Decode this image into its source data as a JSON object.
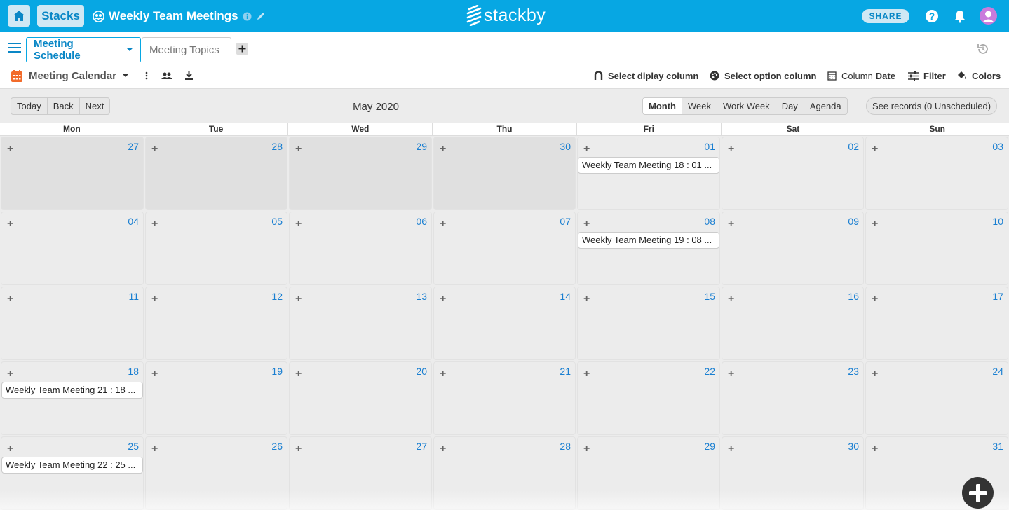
{
  "topbar": {
    "stacks_label": "Stacks",
    "stack_title": "Weekly Team Meetings",
    "logo_text": "stackby",
    "share_label": "SHARE",
    "icons": [
      "home-icon",
      "team-icon",
      "info-icon",
      "pencil-icon",
      "help-icon",
      "bell-icon",
      "user-avatar-icon"
    ],
    "colors": {
      "bar": "#07a7e3",
      "button_bg": "#cfe8f4",
      "accent": "#0a87c6"
    }
  },
  "tabs": [
    {
      "label": "Meeting Schedule",
      "active": true
    },
    {
      "label": "Meeting Topics",
      "active": false
    }
  ],
  "view_toolbar": {
    "view_name": "Meeting Calendar",
    "select_display_column": "Select diplay column",
    "select_option_column": "Select option column",
    "column_label": "Column",
    "column_value": "Date",
    "filter_label": "Filter",
    "colors_label": "Colors"
  },
  "calendar": {
    "nav": [
      "Today",
      "Back",
      "Next"
    ],
    "title": "May 2020",
    "views": [
      {
        "label": "Month",
        "active": true
      },
      {
        "label": "Week",
        "active": false
      },
      {
        "label": "Work Week",
        "active": false
      },
      {
        "label": "Day",
        "active": false
      },
      {
        "label": "Agenda",
        "active": false
      }
    ],
    "see_records": "See records (0 Unscheduled)",
    "weekdays": [
      "Mon",
      "Tue",
      "Wed",
      "Thu",
      "Fri",
      "Sat",
      "Sun"
    ],
    "weeks": [
      [
        {
          "day": "27",
          "off": true
        },
        {
          "day": "28",
          "off": true
        },
        {
          "day": "29",
          "off": true
        },
        {
          "day": "30",
          "off": true
        },
        {
          "day": "01",
          "event": "Weekly Team Meeting 18 : 01 ..."
        },
        {
          "day": "02"
        },
        {
          "day": "03"
        }
      ],
      [
        {
          "day": "04"
        },
        {
          "day": "05"
        },
        {
          "day": "06"
        },
        {
          "day": "07"
        },
        {
          "day": "08",
          "event": "Weekly Team Meeting 19 : 08 ..."
        },
        {
          "day": "09"
        },
        {
          "day": "10"
        }
      ],
      [
        {
          "day": "11"
        },
        {
          "day": "12"
        },
        {
          "day": "13"
        },
        {
          "day": "14"
        },
        {
          "day": "15"
        },
        {
          "day": "16"
        },
        {
          "day": "17"
        }
      ],
      [
        {
          "day": "18",
          "event": "Weekly Team Meeting 21 : 18 ..."
        },
        {
          "day": "19"
        },
        {
          "day": "20"
        },
        {
          "day": "21"
        },
        {
          "day": "22"
        },
        {
          "day": "23"
        },
        {
          "day": "24"
        }
      ],
      [
        {
          "day": "25",
          "event": "Weekly Team Meeting 22 : 25 ..."
        },
        {
          "day": "26"
        },
        {
          "day": "27"
        },
        {
          "day": "28"
        },
        {
          "day": "29"
        },
        {
          "day": "30"
        },
        {
          "day": "31"
        }
      ]
    ]
  }
}
